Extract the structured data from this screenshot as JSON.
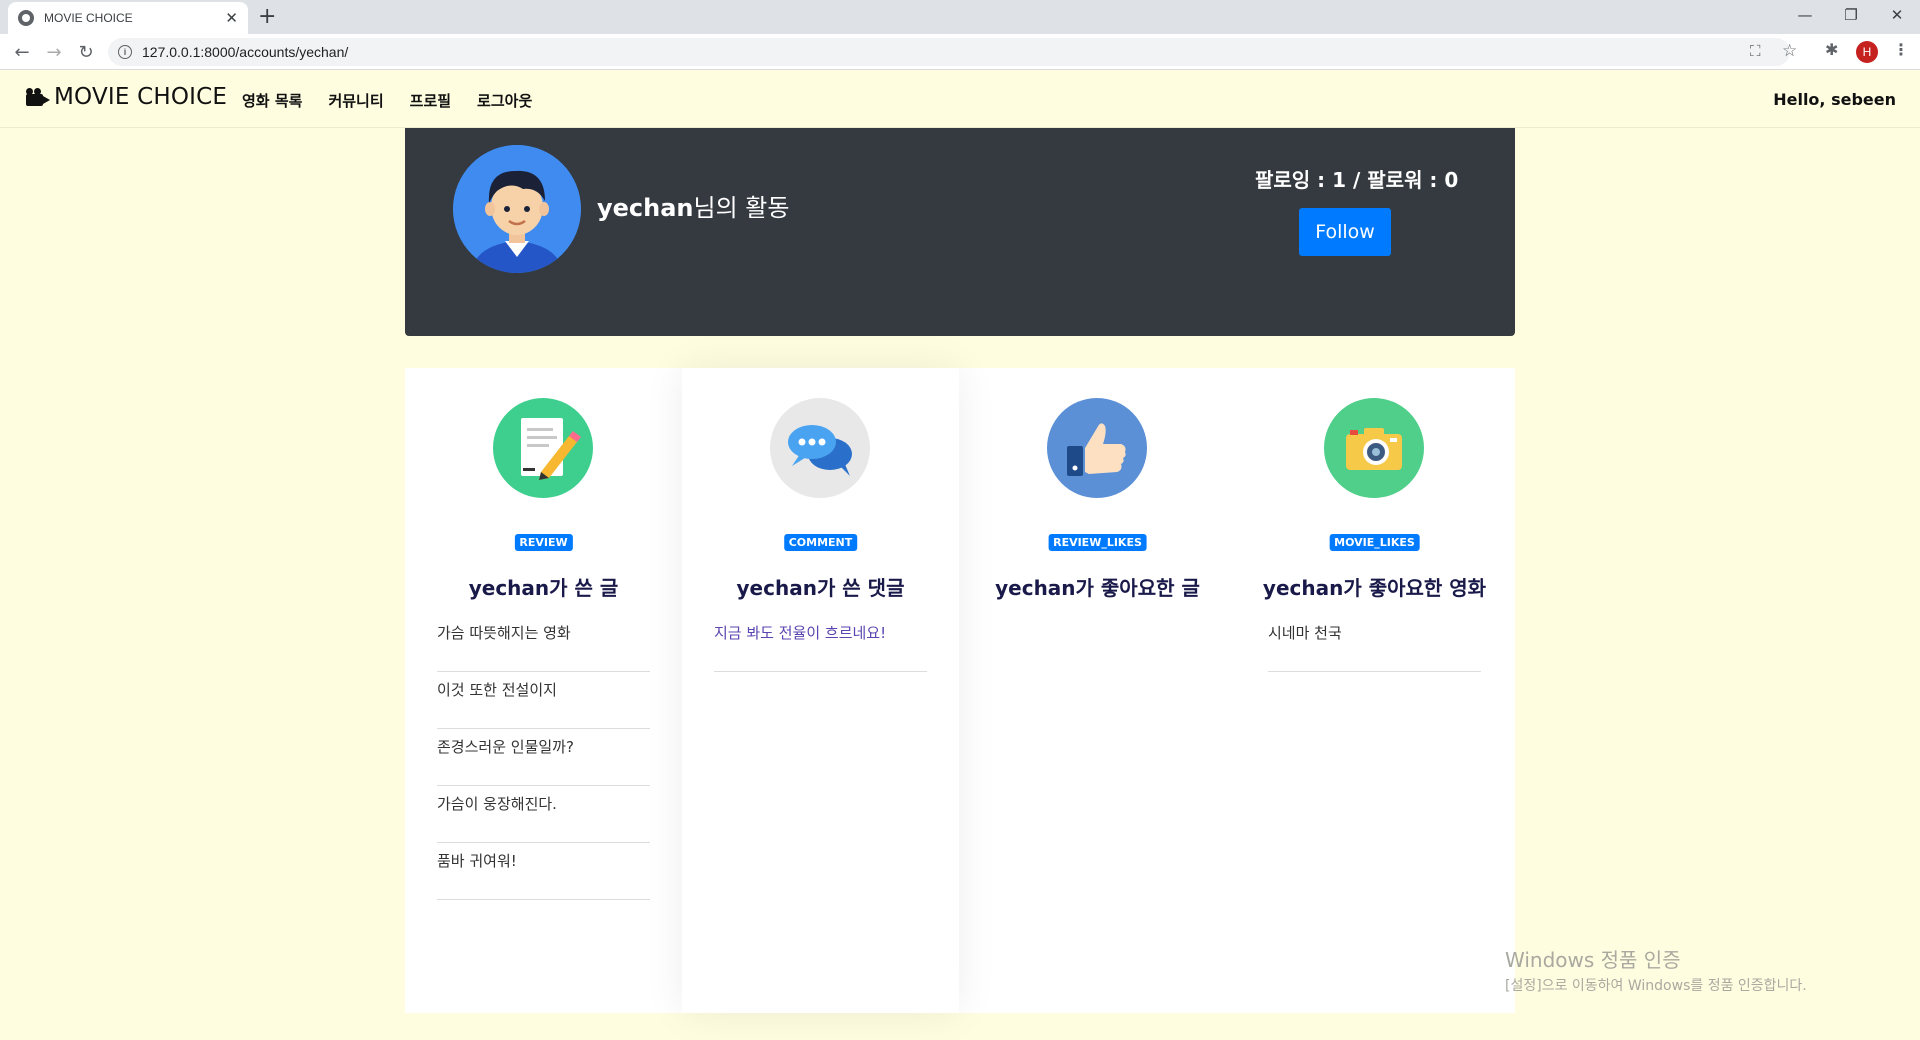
{
  "browser": {
    "tab_title": "MOVIE CHOICE",
    "tab_close": "✕",
    "new_tab": "+",
    "url": "127.0.0.1:8000/accounts/yechan/",
    "profile_initial": "H"
  },
  "navbar": {
    "brand": "MOVIE CHOICE",
    "links": [
      "영화 목록",
      "커뮤니티",
      "프로필",
      "로그아웃"
    ],
    "greeting": "Hello, sebeen"
  },
  "profile": {
    "username": "yechan",
    "activity_suffix": "님의 활동",
    "follow_stats": "팔로잉 : 1 / 팔로워 : 0",
    "follow_button": "Follow"
  },
  "columns": [
    {
      "badge": "REVIEW",
      "title": "yechan가 쓴 글",
      "icon": "notepad-pencil-icon",
      "icon_color": "#3ecf8e",
      "items": [
        "가슴 따뜻해지는 영화",
        "이것 또한 전설이지",
        "존경스러운 인물일까?",
        "가슴이 웅장해진다.",
        "품바 귀여워!"
      ]
    },
    {
      "badge": "COMMENT",
      "title": "yechan가 쓴 댓글",
      "icon": "chat-bubbles-icon",
      "icon_color": "#e8e8e8",
      "items": [
        "지금 봐도 전율이 흐르네요!"
      ]
    },
    {
      "badge": "REVIEW_LIKES",
      "title": "yechan가 좋아요한 글",
      "icon": "thumbs-up-icon",
      "icon_color": "#5b8fd6",
      "items": []
    },
    {
      "badge": "MOVIE_LIKES",
      "title": "yechan가 좋아요한 영화",
      "icon": "camera-icon",
      "icon_color": "#4fcf8a",
      "items": [
        "시네마 천국"
      ]
    }
  ],
  "watermark": {
    "line1": "Windows 정품 인증",
    "line2": "[설정]으로 이동하여 Windows를 정품 인증합니다."
  }
}
